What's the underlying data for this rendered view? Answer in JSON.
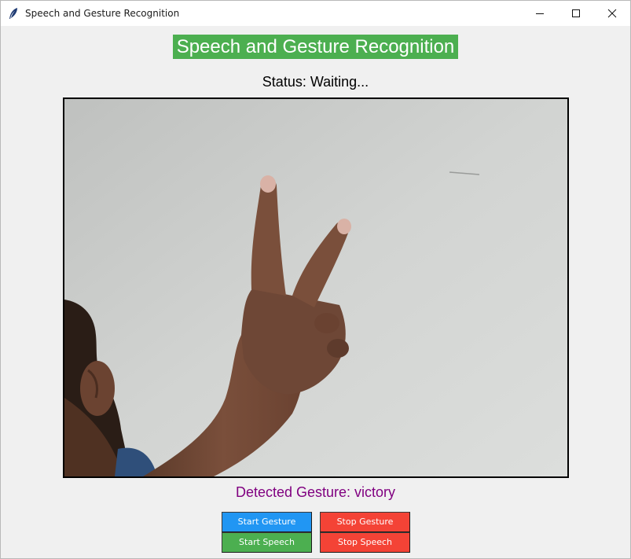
{
  "window": {
    "title": "Speech and Gesture Recognition",
    "controls": [
      "minimize-icon",
      "maximize-icon",
      "close-icon"
    ]
  },
  "app": {
    "heading": "Speech and Gesture Recognition",
    "status": "Status: Waiting...",
    "detected_gesture": "Detected Gesture: victory"
  },
  "buttons": {
    "start_gesture": "Start Gesture",
    "stop_gesture": "Stop Gesture",
    "start_speech": "Start Speech",
    "stop_speech": "Stop Speech"
  },
  "colors": {
    "heading_bg": "#4caf50",
    "start_gesture_bg": "#2196f3",
    "stop_bg": "#f44336",
    "start_speech_bg": "#4caf50",
    "gesture_text": "#800080"
  },
  "feed": {
    "content": "webcam frame: hand showing victory sign"
  }
}
